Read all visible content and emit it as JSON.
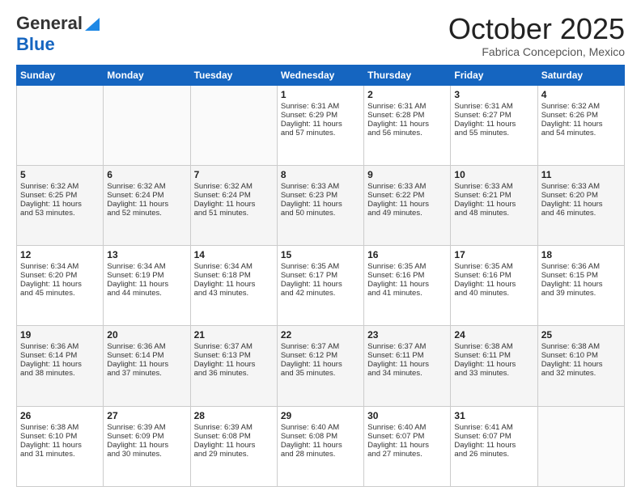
{
  "logo": {
    "general": "General",
    "blue": "Blue"
  },
  "header": {
    "month": "October 2025",
    "location": "Fabrica Concepcion, Mexico"
  },
  "days_of_week": [
    "Sunday",
    "Monday",
    "Tuesday",
    "Wednesday",
    "Thursday",
    "Friday",
    "Saturday"
  ],
  "weeks": [
    [
      {
        "day": "",
        "info": ""
      },
      {
        "day": "",
        "info": ""
      },
      {
        "day": "",
        "info": ""
      },
      {
        "day": "1",
        "info": "Sunrise: 6:31 AM\nSunset: 6:29 PM\nDaylight: 11 hours\nand 57 minutes."
      },
      {
        "day": "2",
        "info": "Sunrise: 6:31 AM\nSunset: 6:28 PM\nDaylight: 11 hours\nand 56 minutes."
      },
      {
        "day": "3",
        "info": "Sunrise: 6:31 AM\nSunset: 6:27 PM\nDaylight: 11 hours\nand 55 minutes."
      },
      {
        "day": "4",
        "info": "Sunrise: 6:32 AM\nSunset: 6:26 PM\nDaylight: 11 hours\nand 54 minutes."
      }
    ],
    [
      {
        "day": "5",
        "info": "Sunrise: 6:32 AM\nSunset: 6:25 PM\nDaylight: 11 hours\nand 53 minutes."
      },
      {
        "day": "6",
        "info": "Sunrise: 6:32 AM\nSunset: 6:24 PM\nDaylight: 11 hours\nand 52 minutes."
      },
      {
        "day": "7",
        "info": "Sunrise: 6:32 AM\nSunset: 6:24 PM\nDaylight: 11 hours\nand 51 minutes."
      },
      {
        "day": "8",
        "info": "Sunrise: 6:33 AM\nSunset: 6:23 PM\nDaylight: 11 hours\nand 50 minutes."
      },
      {
        "day": "9",
        "info": "Sunrise: 6:33 AM\nSunset: 6:22 PM\nDaylight: 11 hours\nand 49 minutes."
      },
      {
        "day": "10",
        "info": "Sunrise: 6:33 AM\nSunset: 6:21 PM\nDaylight: 11 hours\nand 48 minutes."
      },
      {
        "day": "11",
        "info": "Sunrise: 6:33 AM\nSunset: 6:20 PM\nDaylight: 11 hours\nand 46 minutes."
      }
    ],
    [
      {
        "day": "12",
        "info": "Sunrise: 6:34 AM\nSunset: 6:20 PM\nDaylight: 11 hours\nand 45 minutes."
      },
      {
        "day": "13",
        "info": "Sunrise: 6:34 AM\nSunset: 6:19 PM\nDaylight: 11 hours\nand 44 minutes."
      },
      {
        "day": "14",
        "info": "Sunrise: 6:34 AM\nSunset: 6:18 PM\nDaylight: 11 hours\nand 43 minutes."
      },
      {
        "day": "15",
        "info": "Sunrise: 6:35 AM\nSunset: 6:17 PM\nDaylight: 11 hours\nand 42 minutes."
      },
      {
        "day": "16",
        "info": "Sunrise: 6:35 AM\nSunset: 6:16 PM\nDaylight: 11 hours\nand 41 minutes."
      },
      {
        "day": "17",
        "info": "Sunrise: 6:35 AM\nSunset: 6:16 PM\nDaylight: 11 hours\nand 40 minutes."
      },
      {
        "day": "18",
        "info": "Sunrise: 6:36 AM\nSunset: 6:15 PM\nDaylight: 11 hours\nand 39 minutes."
      }
    ],
    [
      {
        "day": "19",
        "info": "Sunrise: 6:36 AM\nSunset: 6:14 PM\nDaylight: 11 hours\nand 38 minutes."
      },
      {
        "day": "20",
        "info": "Sunrise: 6:36 AM\nSunset: 6:14 PM\nDaylight: 11 hours\nand 37 minutes."
      },
      {
        "day": "21",
        "info": "Sunrise: 6:37 AM\nSunset: 6:13 PM\nDaylight: 11 hours\nand 36 minutes."
      },
      {
        "day": "22",
        "info": "Sunrise: 6:37 AM\nSunset: 6:12 PM\nDaylight: 11 hours\nand 35 minutes."
      },
      {
        "day": "23",
        "info": "Sunrise: 6:37 AM\nSunset: 6:11 PM\nDaylight: 11 hours\nand 34 minutes."
      },
      {
        "day": "24",
        "info": "Sunrise: 6:38 AM\nSunset: 6:11 PM\nDaylight: 11 hours\nand 33 minutes."
      },
      {
        "day": "25",
        "info": "Sunrise: 6:38 AM\nSunset: 6:10 PM\nDaylight: 11 hours\nand 32 minutes."
      }
    ],
    [
      {
        "day": "26",
        "info": "Sunrise: 6:38 AM\nSunset: 6:10 PM\nDaylight: 11 hours\nand 31 minutes."
      },
      {
        "day": "27",
        "info": "Sunrise: 6:39 AM\nSunset: 6:09 PM\nDaylight: 11 hours\nand 30 minutes."
      },
      {
        "day": "28",
        "info": "Sunrise: 6:39 AM\nSunset: 6:08 PM\nDaylight: 11 hours\nand 29 minutes."
      },
      {
        "day": "29",
        "info": "Sunrise: 6:40 AM\nSunset: 6:08 PM\nDaylight: 11 hours\nand 28 minutes."
      },
      {
        "day": "30",
        "info": "Sunrise: 6:40 AM\nSunset: 6:07 PM\nDaylight: 11 hours\nand 27 minutes."
      },
      {
        "day": "31",
        "info": "Sunrise: 6:41 AM\nSunset: 6:07 PM\nDaylight: 11 hours\nand 26 minutes."
      },
      {
        "day": "",
        "info": ""
      }
    ]
  ]
}
